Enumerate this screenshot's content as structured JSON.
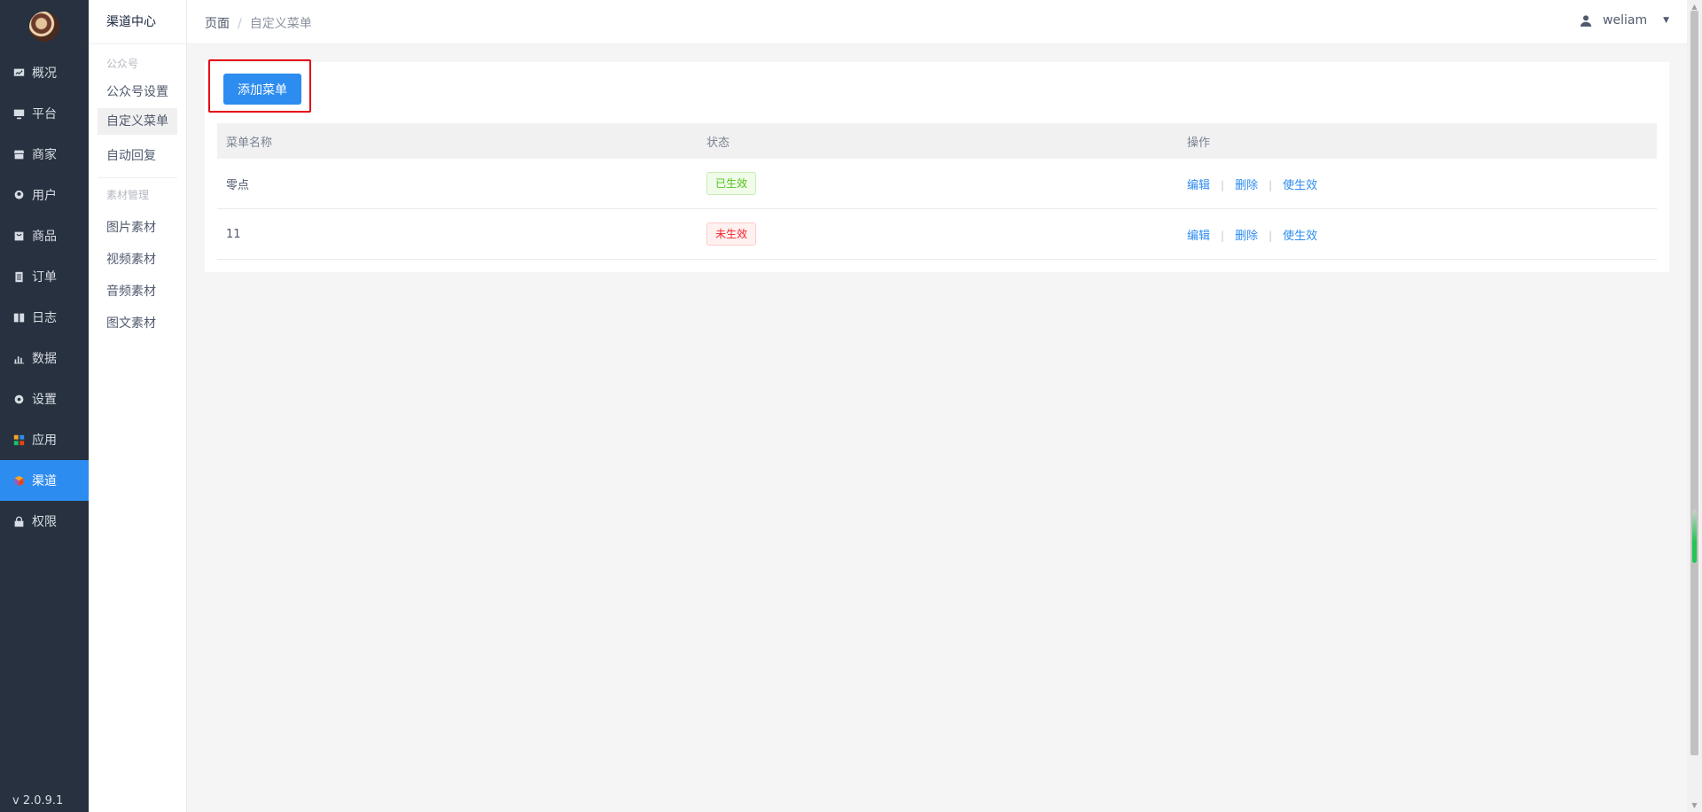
{
  "sidebar": {
    "items": [
      {
        "label": "概况",
        "icon": "dashboard-icon",
        "active": false
      },
      {
        "label": "平台",
        "icon": "monitor-icon",
        "active": false
      },
      {
        "label": "商家",
        "icon": "store-icon",
        "active": false
      },
      {
        "label": "用户",
        "icon": "user-icon",
        "active": false
      },
      {
        "label": "商品",
        "icon": "bag-icon",
        "active": false
      },
      {
        "label": "订单",
        "icon": "clipboard-icon",
        "active": false
      },
      {
        "label": "日志",
        "icon": "book-icon",
        "active": false
      },
      {
        "label": "数据",
        "icon": "bar-chart-icon",
        "active": false
      },
      {
        "label": "设置",
        "icon": "gear-icon",
        "active": false
      },
      {
        "label": "应用",
        "icon": "apps-grid-icon",
        "active": false
      },
      {
        "label": "渠道",
        "icon": "cube-icon",
        "active": true
      },
      {
        "label": "权限",
        "icon": "lock-icon",
        "active": false
      }
    ],
    "version": "v 2.0.9.1"
  },
  "submenu": {
    "title": "渠道中心",
    "group1": "公众号",
    "group1_items": [
      "公众号设置",
      "自定义菜单",
      "自动回复"
    ],
    "group2": "素材管理",
    "group2_items": [
      "图片素材",
      "视频素材",
      "音频素材",
      "图文素材"
    ]
  },
  "header": {
    "breadcrumb_root": "页面",
    "breadcrumb_sep": "/",
    "breadcrumb_current": "自定义菜单",
    "username": "weliam"
  },
  "main": {
    "add_button": "添加菜单",
    "columns": [
      "菜单名称",
      "状态",
      "操作"
    ],
    "rows": [
      {
        "name": "零点",
        "status": "已生效",
        "status_type": "active",
        "actions": [
          "编辑",
          "删除",
          "使生效"
        ]
      },
      {
        "name": "11",
        "status": "未生效",
        "status_type": "inactive",
        "actions": [
          "编辑",
          "删除",
          "使生效"
        ]
      }
    ]
  },
  "colors": {
    "sidebar_bg": "#28313f",
    "accent": "#2d8cf0",
    "highlight_border": "#e60012",
    "success": "#52c41a",
    "error": "#f5222d"
  }
}
